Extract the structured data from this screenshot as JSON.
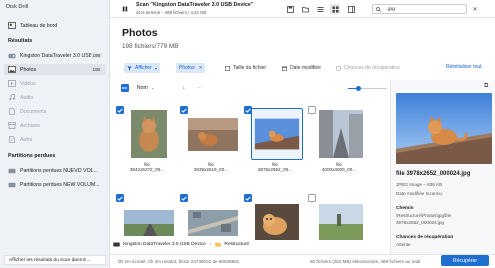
{
  "app": {
    "title": "Disk Drill"
  },
  "sidebar": {
    "dashboard": "Tableau de bord",
    "results_heading": "Résultats",
    "items": [
      {
        "label": "Kingston DataTraveler 3.0 USB Device",
        "count": "198"
      },
      {
        "label": "Photos",
        "count": "198"
      },
      {
        "label": "Vidéos"
      },
      {
        "label": "Audio"
      },
      {
        "label": "Documents"
      },
      {
        "label": "Archives"
      },
      {
        "label": "Autre"
      }
    ],
    "lost_heading": "Partitions perdues",
    "lost": [
      {
        "label": "Partitions perdues NUEVO VOL..."
      },
      {
        "label": "Partitions perdues NEW VOLUM..."
      }
    ],
    "footer": "Afficher les résultats du scan dans E..."
  },
  "topbar": {
    "title": "Scan \"Kingston DataTraveler 3.0 USB Device\"",
    "subtitle": "41% terminé – 489 fichiers / 4,44 GB",
    "search_value": ".jpg"
  },
  "main": {
    "title": "Photos",
    "subtitle": "198 fichiers/779 MB"
  },
  "filters": {
    "show": "Afficher",
    "photos": "Photos",
    "file_size": "Taille du fichier",
    "date_modified": "Date modifiée",
    "recovery_chances": "Chances de récupération",
    "reset": "Réinitialiser tout"
  },
  "list_header": {
    "name": "Nom"
  },
  "files": [
    {
      "name": "file\n3942x5272_00...",
      "checked": true,
      "scene": "cat"
    },
    {
      "name": "file\n3939x2619_00...",
      "checked": true,
      "scene": "cat-room"
    },
    {
      "name": "file\n3978x2652_00...",
      "checked": true,
      "scene": "cat-roof",
      "selected": true
    },
    {
      "name": "file\n4000x3000_00...",
      "checked": false,
      "scene": "street"
    },
    {
      "name": "",
      "checked": true,
      "scene": "road"
    },
    {
      "name": "",
      "checked": true,
      "scene": "aerial"
    },
    {
      "name": "",
      "checked": true,
      "scene": "cat-orange"
    },
    {
      "name": "",
      "checked": false,
      "scene": "field"
    }
  ],
  "pathbar": {
    "device": "Kingston DataTraveler 3.0 USB Device",
    "folder": "Restructuré"
  },
  "preview": {
    "filename": "file 3978x2652_000024.jpg",
    "type": "JPEG Image – 836 KB",
    "date": "Date modifiée Inconnu",
    "path_label": "Chemin",
    "path_value": "\\Restructuré\\Photos\\jpg\\file",
    "path_value2": "3978x2652_000024.jpg",
    "chances_label": "Chances de récupération",
    "chances_value": "Attente"
  },
  "statusbar": {
    "left": "0h 2m écoulé, 0h 3m restant, block 24748032 de 60538881",
    "right": "80 fichiers (253 MB) sélectionnés, 489 fichiers au total",
    "recover": "Récupérer"
  },
  "colors": {
    "accent": "#1f6fd1",
    "sidebar_bg": "#eef1f5"
  }
}
